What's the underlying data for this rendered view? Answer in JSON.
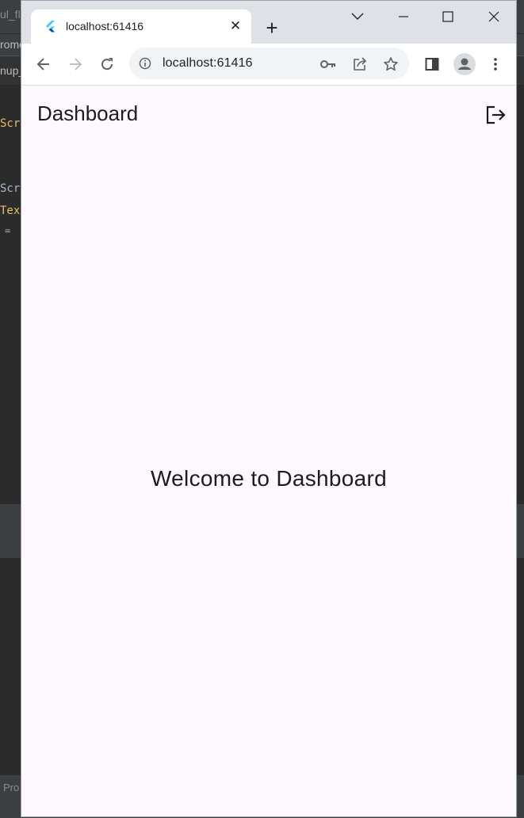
{
  "ide": {
    "tab_fragment": "ul_flu",
    "bar2_fragment": "rome",
    "bar3_fragment": "nup_",
    "code_lines": [
      "Scr",
      "Scr",
      "Tex",
      "="
    ],
    "bottom_fragment": "Pro",
    "colors": {
      "keyword": "#e8bf6a",
      "text": "#a9b7c6"
    }
  },
  "browser": {
    "tab": {
      "title": "localhost:61416",
      "favicon": "flutter-logo"
    },
    "new_tab_label": "+",
    "window_controls": [
      "tab-search",
      "minimize",
      "maximize",
      "close"
    ],
    "address": {
      "url": "localhost:61416"
    },
    "toolbar_icons": [
      "back",
      "forward",
      "reload",
      "site-info",
      "key",
      "share",
      "star",
      "side-panel",
      "profile",
      "menu"
    ]
  },
  "app": {
    "appbar": {
      "title": "Dashboard",
      "action_icon": "logout-icon"
    },
    "body": {
      "message": "Welcome to Dashboard"
    },
    "colors": {
      "background": "#fdf8fc",
      "text": "#1d1b20"
    }
  }
}
